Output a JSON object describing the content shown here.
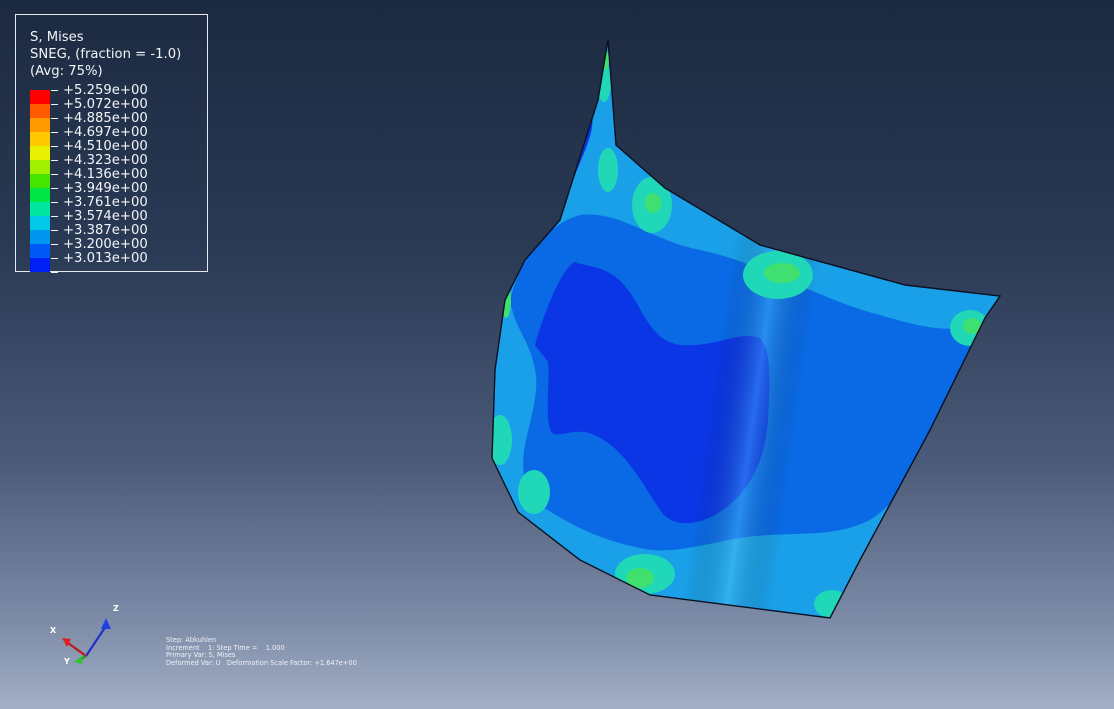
{
  "legend": {
    "title_lines": [
      "S, Mises",
      "SNEG, (fraction = -1.0)",
      "(Avg: 75%)"
    ],
    "levels": [
      {
        "label": "+5.259e+00",
        "color": "#ff0000"
      },
      {
        "label": "+5.072e+00",
        "color": "#ff5a00"
      },
      {
        "label": "+4.885e+00",
        "color": "#ff9a00"
      },
      {
        "label": "+4.697e+00",
        "color": "#ffc800"
      },
      {
        "label": "+4.510e+00",
        "color": "#e6f000"
      },
      {
        "label": "+4.323e+00",
        "color": "#a0f000"
      },
      {
        "label": "+4.136e+00",
        "color": "#46e600"
      },
      {
        "label": "+3.949e+00",
        "color": "#00e646"
      },
      {
        "label": "+3.761e+00",
        "color": "#00e6a0"
      },
      {
        "label": "+3.574e+00",
        "color": "#00c8e6"
      },
      {
        "label": "+3.387e+00",
        "color": "#0096f0"
      },
      {
        "label": "+3.200e+00",
        "color": "#0058f5"
      },
      {
        "label": "+3.013e+00",
        "color": "#0020f5"
      }
    ]
  },
  "triad": {
    "x_label": "X",
    "y_label": "Y",
    "z_label": "Z"
  },
  "info": {
    "step": "Step: Abkuhlen",
    "increment": "Increment    1: Step Time =    1.000",
    "primary_var": "Primary Var: S, Mises",
    "deformed_var": "Deformed Var: U   Deformation Scale Factor: +1.647e+00"
  },
  "contour_colors": {
    "light": "#1aa0e8",
    "mid": "#0a6ae6",
    "dark": "#0a36e6",
    "hot": "#20d8b8",
    "hot_core": "#40e070"
  }
}
